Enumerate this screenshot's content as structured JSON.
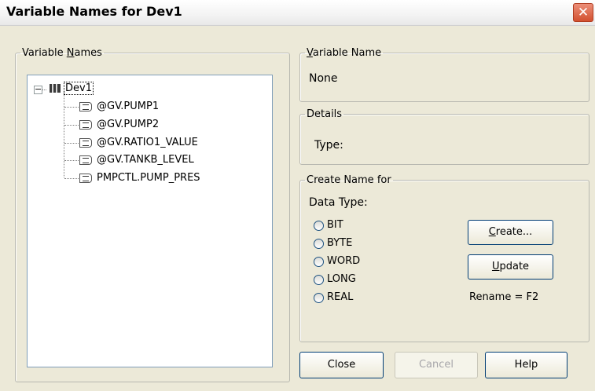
{
  "window": {
    "title": "Variable Names for Dev1",
    "close_glyph": "✕"
  },
  "left_group": {
    "label_pre": "Variable ",
    "label_mnemonic": "N",
    "label_post": "ames"
  },
  "tree": {
    "expander": "−",
    "root": "Dev1",
    "items": [
      "@GV.PUMP1",
      "@GV.PUMP2",
      "@GV.RATIO1_VALUE",
      "@GV.TANKB_LEVEL",
      "PMPCTL.PUMP_PRES"
    ]
  },
  "variable_name": {
    "label_mnemonic": "V",
    "label_post": "ariable Name",
    "value": "None"
  },
  "details": {
    "label": "Details",
    "type_label": "Type:"
  },
  "create": {
    "label": "Create Name for",
    "data_type_label": "Data Type:",
    "options": [
      "BIT",
      "BYTE",
      "WORD",
      "LONG",
      "REAL"
    ],
    "create_mnemonic": "C",
    "create_post": "reate...",
    "update_mnemonic": "U",
    "update_post": "pdate",
    "rename_hint": "Rename = F2"
  },
  "buttons": {
    "close": "Close",
    "cancel": "Cancel",
    "help": "Help"
  }
}
